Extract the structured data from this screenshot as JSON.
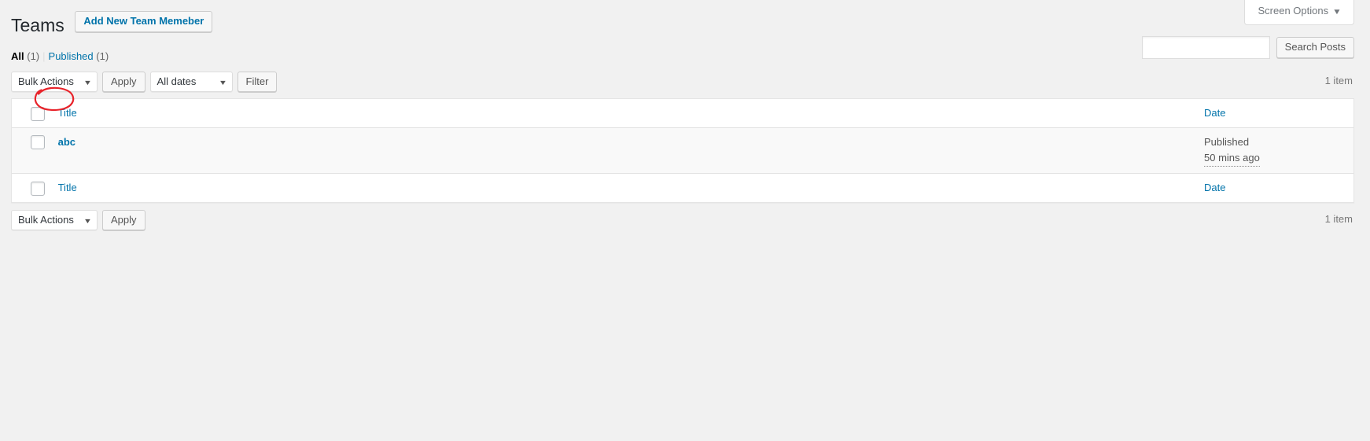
{
  "screen_meta": {
    "screen_options_label": "Screen Options",
    "caret": "▼"
  },
  "header": {
    "page_title": "Teams",
    "add_new_label": "Add New Team Memeber"
  },
  "search": {
    "value": "",
    "placeholder": "",
    "submit_label": "Search Posts"
  },
  "views": {
    "all_label": "All",
    "all_count": "(1)",
    "separator": "|",
    "published_label": "Published",
    "published_count": "(1)"
  },
  "tablenav_top": {
    "bulk_actions_label": "Bulk Actions",
    "bulk_caret": "▼",
    "apply_label": "Apply",
    "dates_label": "All dates",
    "dates_caret": "▼",
    "filter_label": "Filter",
    "displaying_num": "1 item"
  },
  "tablenav_bottom": {
    "bulk_actions_label": "Bulk Actions",
    "bulk_caret": "▼",
    "apply_label": "Apply",
    "displaying_num": "1 item"
  },
  "table": {
    "columns": {
      "title": "Title",
      "date": "Date"
    },
    "footer_columns": {
      "title": "Title",
      "date": "Date"
    },
    "rows": [
      {
        "title": "abc",
        "date_status": "Published",
        "date_relative": "50 mins ago"
      }
    ]
  },
  "annotation": {
    "color": "#e8232a",
    "target": "Title"
  }
}
